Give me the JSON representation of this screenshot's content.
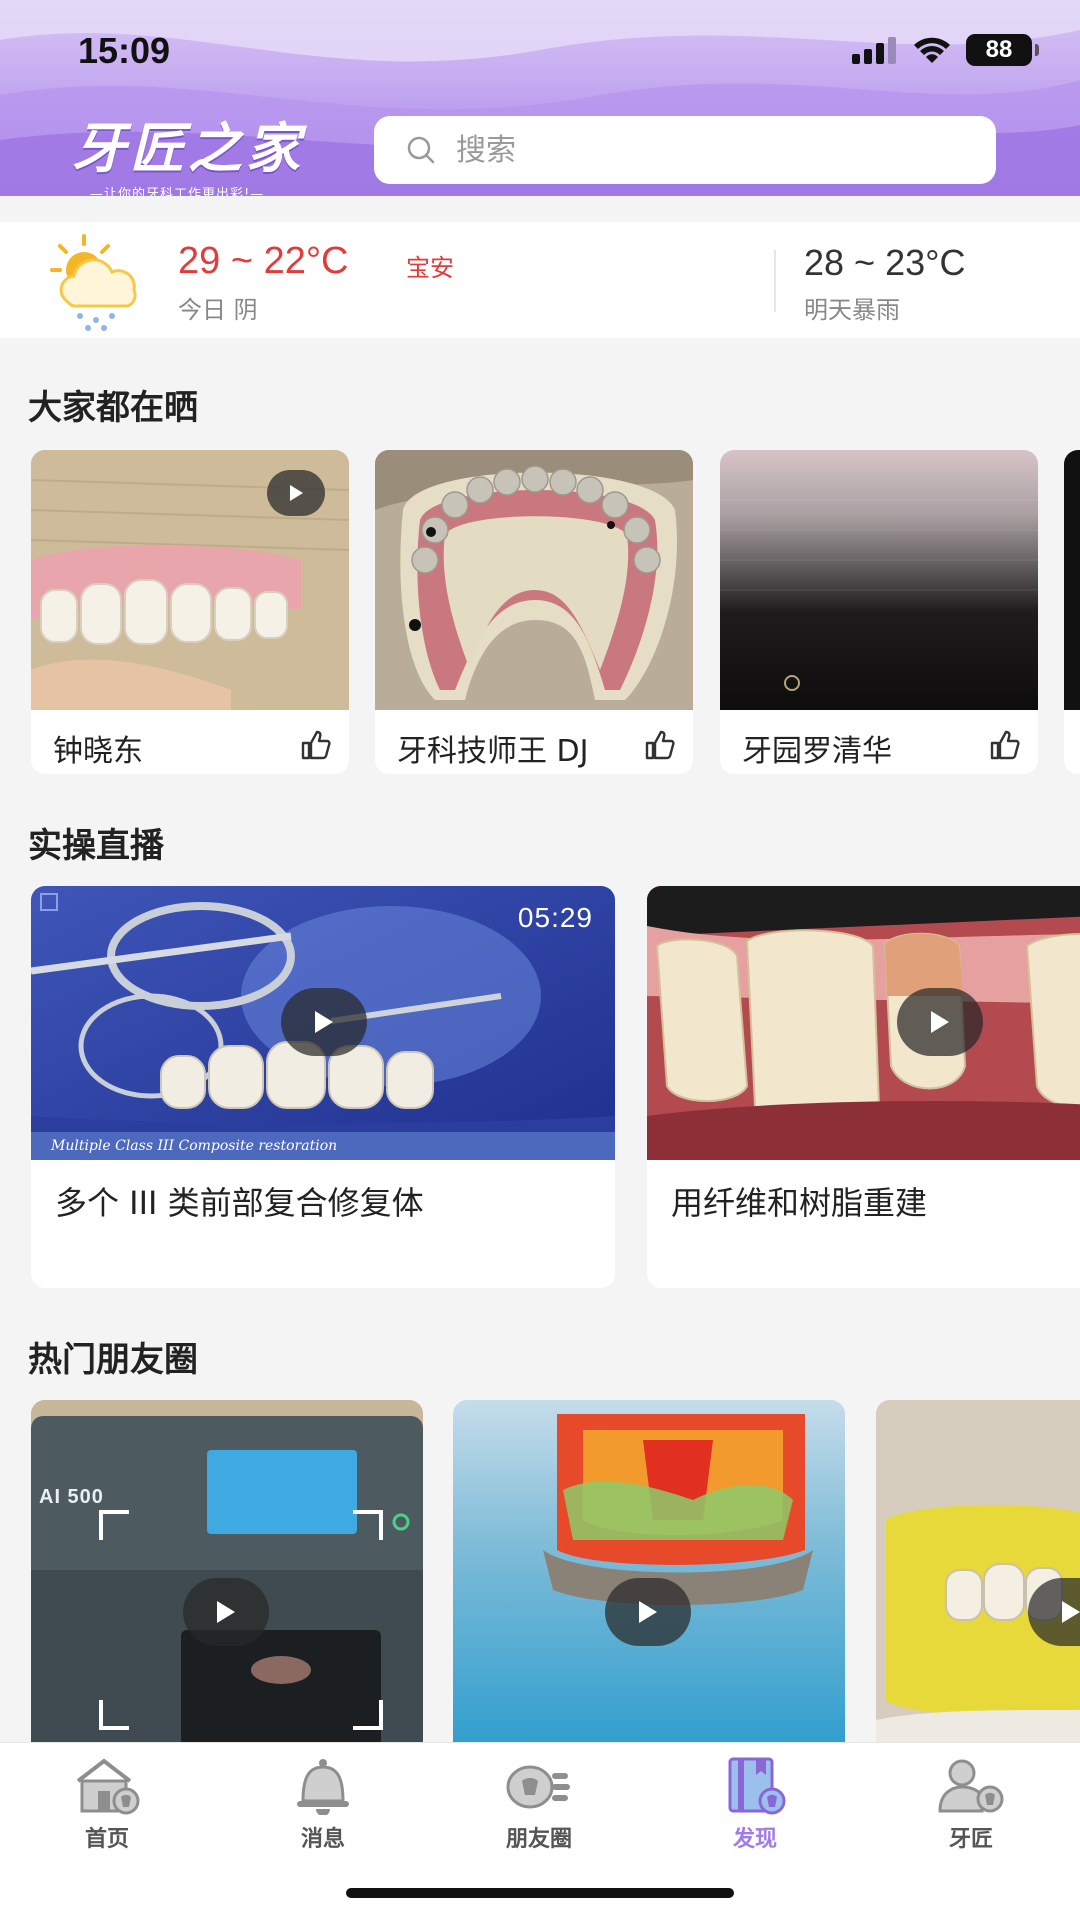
{
  "status_bar": {
    "time": "15:09",
    "battery": "88"
  },
  "header": {
    "logo_title": "牙匠之家",
    "logo_slogan": "—让你的牙科工作更出彩!—",
    "search_placeholder": "搜索"
  },
  "weather": {
    "today_temp": "29 ~ 22°C",
    "city": "宝安",
    "today_desc": "今日 阴",
    "tomorrow_temp": "28 ~ 23°C",
    "tomorrow_desc": "明天暴雨"
  },
  "showcase": {
    "title": "大家都在晒",
    "items": [
      {
        "name": "钟晓东",
        "has_video": true
      },
      {
        "name": "牙科技师王 DJ",
        "has_video": false
      },
      {
        "name": "牙园罗清华",
        "has_video": false
      }
    ]
  },
  "live": {
    "title": "实操直播",
    "items": [
      {
        "title": "多个 III 类前部复合修复体",
        "duration": "05:29",
        "caption": "Multiple Class III Composite restoration"
      },
      {
        "title": "用纤维和树脂重建",
        "duration": "",
        "caption": ""
      }
    ]
  },
  "moments": {
    "title": "热门朋友圈",
    "items": [
      {
        "brand": "AI 500"
      },
      {
        "brand": ""
      },
      {
        "brand": ""
      }
    ]
  },
  "tabbar": {
    "items": [
      {
        "label": "首页",
        "icon": "home-icon",
        "active": false
      },
      {
        "label": "消息",
        "icon": "bell-icon",
        "active": false
      },
      {
        "label": "朋友圈",
        "icon": "moments-icon",
        "active": false
      },
      {
        "label": "发现",
        "icon": "discover-icon",
        "active": true
      },
      {
        "label": "牙匠",
        "icon": "user-tooth-icon",
        "active": false
      }
    ],
    "accent": "#a17ce8"
  }
}
